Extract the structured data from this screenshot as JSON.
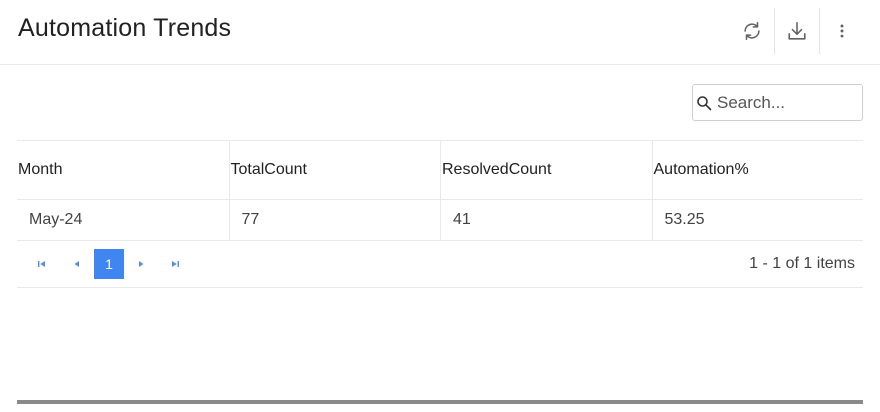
{
  "header": {
    "title": "Automation Trends",
    "icons": [
      "refresh-icon",
      "download-icon",
      "more-vert-icon"
    ]
  },
  "search": {
    "placeholder": "Search...",
    "value": ""
  },
  "grid": {
    "columns": [
      "Month",
      "TotalCount",
      "ResolvedCount",
      "Automation%"
    ],
    "rows": [
      [
        "May-24",
        "77",
        "41",
        "53.25"
      ]
    ]
  },
  "pager": {
    "current_page": "1",
    "info": "1 - 1 of 1 items"
  },
  "colors": {
    "accent": "#3f86f0",
    "border": "#e8e8e8",
    "icon": "#616161"
  }
}
